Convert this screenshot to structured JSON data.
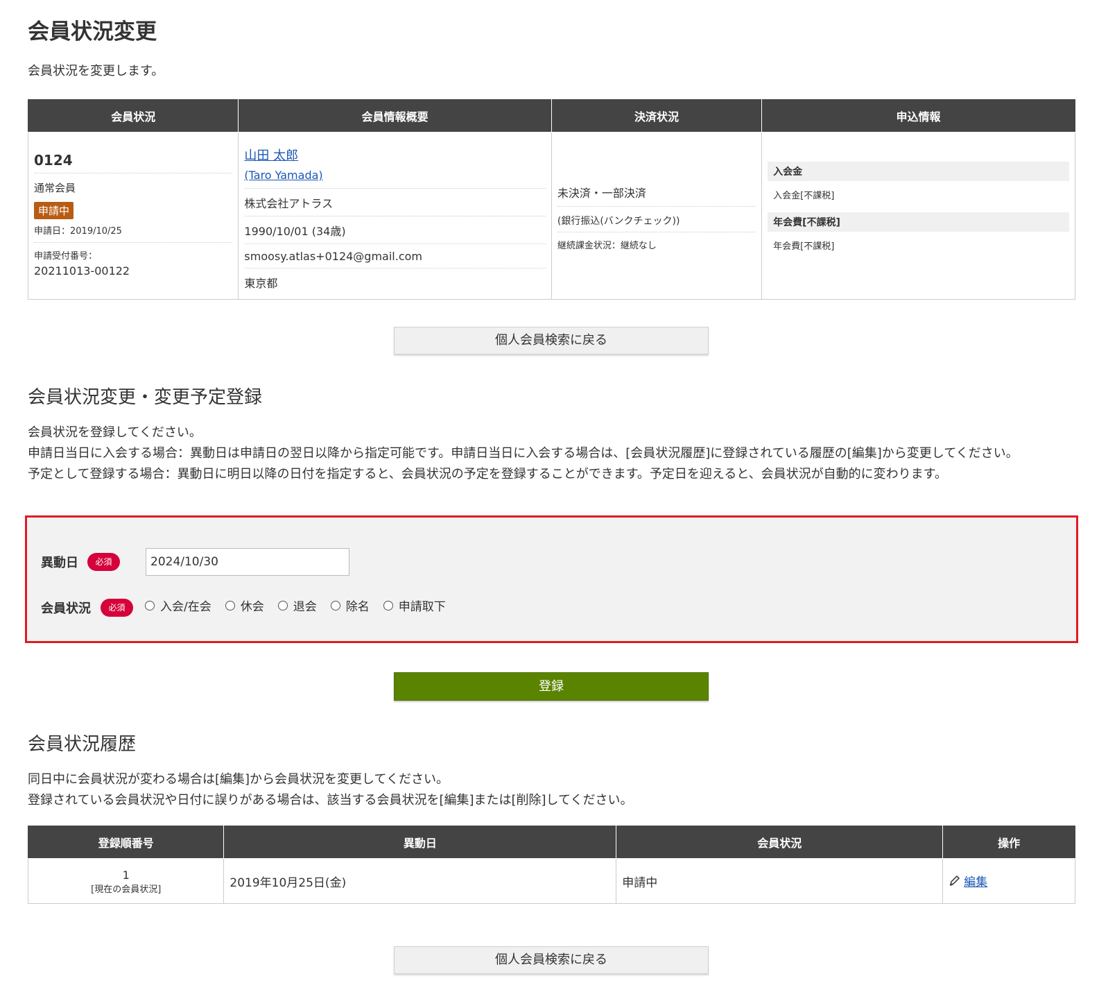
{
  "page": {
    "title": "会員状況変更",
    "description": "会員状況を変更します。"
  },
  "member_table": {
    "headers": [
      "会員状況",
      "会員情報概要",
      "決済状況",
      "申込情報"
    ],
    "status": {
      "member_no": "0124",
      "member_type": "通常会員",
      "badge": "申請中",
      "apply_date": "申請日：2019/10/25",
      "receipt_label": "申請受付番号：",
      "receipt_no": "20211013-00122"
    },
    "info": {
      "name": "山田 太郎",
      "romaji": "(Taro Yamada)",
      "company": "株式会社アトラス",
      "birthday": "1990/10/01 (34歳)",
      "email": "smoosy.atlas+0124@gmail.com",
      "prefecture": "東京都"
    },
    "payment": {
      "status": "未決済・一部決済",
      "method": "(銀行振込(バンクチェック))",
      "recurring": "継続課金状況：継続なし"
    },
    "application": {
      "entry_fee_head": "入会金",
      "entry_fee_body": "入会金[不課税]",
      "annual_fee_head": "年会費[不課税]",
      "annual_fee_body": "年会費[不課税]"
    }
  },
  "back_button_label": "個人会員検索に戻る",
  "register_section": {
    "title": "会員状況変更・変更予定登録",
    "desc1": "会員状況を登録してください。",
    "desc2": "申請日当日に入会する場合：異動日は申請日の翌日以降から指定可能です。申請日当日に入会する場合は、[会員状況履歴]に登録されている履歴の[編集]から変更してください。",
    "desc3": "予定として登録する場合：異動日に明日以降の日付を指定すると、会員状況の予定を登録することができます。予定日を迎えると、会員状況が自動的に変わります。",
    "date_label": "異動日",
    "required": "必須",
    "date_value": "2024/10/30",
    "status_label": "会員状況",
    "options": [
      "入会/在会",
      "休会",
      "退会",
      "除名",
      "申請取下"
    ],
    "register_label": "登録"
  },
  "history_section": {
    "title": "会員状況履歴",
    "desc1": "同日中に会員状況が変わる場合は[編集]から会員状況を変更してください。",
    "desc2": "登録されている会員状況や日付に誤りがある場合は、該当する会員状況を[編集]または[削除]してください。",
    "headers": [
      "登録順番号",
      "異動日",
      "会員状況",
      "操作"
    ],
    "rows": [
      {
        "no": "1",
        "current": "[現在の会員状況]",
        "date": "2019年10月25日(金)",
        "status": "申請中",
        "action": "編集"
      }
    ]
  },
  "colors": {
    "header_bg": "#444444",
    "badge": "#b85c14",
    "required": "#d6003a",
    "register_button": "#5a8400",
    "highlight_border": "#e01b24",
    "link": "#1a56b5"
  }
}
